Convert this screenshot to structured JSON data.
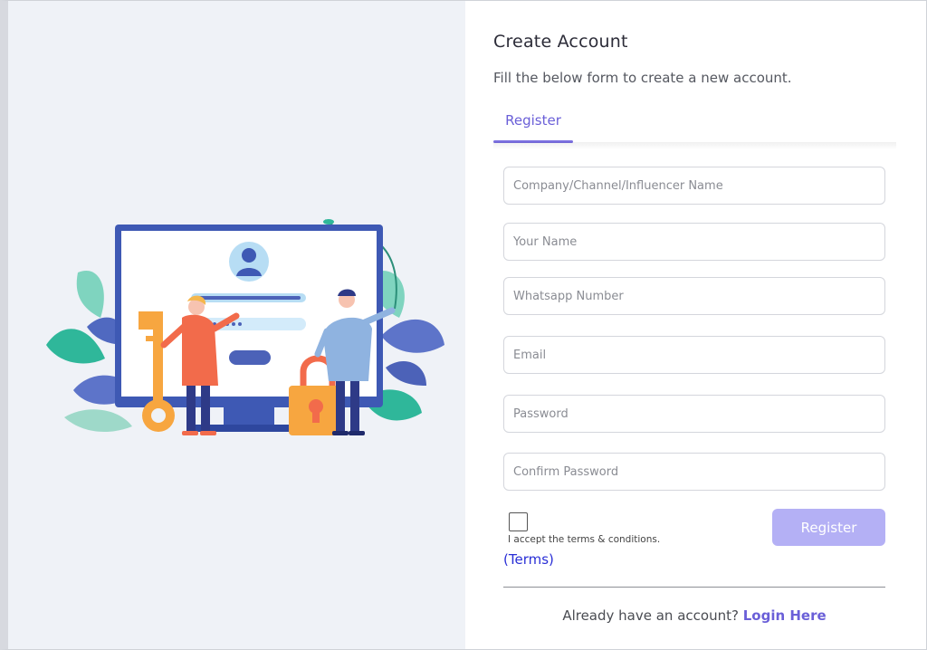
{
  "header": {
    "title": "Create Account",
    "subtitle": "Fill the below form to create a new account."
  },
  "tabs": [
    {
      "label": "Register",
      "active": true
    }
  ],
  "form": {
    "fields": [
      {
        "placeholder": "Company/Channel/Influencer Name",
        "value": ""
      },
      {
        "placeholder": "Your Name",
        "value": ""
      },
      {
        "placeholder": "Whatsapp Number",
        "value": ""
      },
      {
        "placeholder": "Email",
        "value": ""
      },
      {
        "placeholder": "Password",
        "value": ""
      },
      {
        "placeholder": "Confirm Password",
        "value": ""
      }
    ],
    "accept_label": "I accept the terms & conditions.",
    "terms_link": "(Terms)",
    "accepted": false,
    "register_label": "Register"
  },
  "footer": {
    "prompt": "Already have an account?",
    "login_link": "Login Here"
  },
  "colors": {
    "accent": "#6a5fd8",
    "button_disabled": "#b4b0f5",
    "left_panel_bg": "#eff2f7"
  },
  "illustration": {
    "icons": [
      "monitor-icon",
      "user-avatar-icon",
      "key-icon",
      "padlock-icon",
      "person-icon",
      "leaf-icon"
    ]
  }
}
